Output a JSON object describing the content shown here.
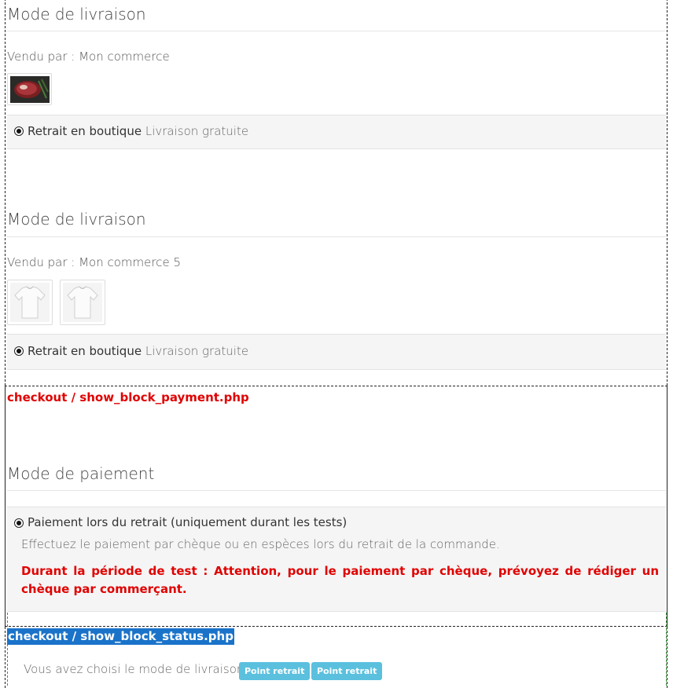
{
  "delivery_blocks": [
    {
      "title": "Mode de livraison",
      "vendor": "Vendu par : Mon commerce",
      "products": [
        {
          "icon": "steak-product-thumbnail"
        }
      ],
      "option": {
        "name": "Retrait en boutique",
        "detail": "Livraison gratuite"
      }
    },
    {
      "title": "Mode de livraison",
      "vendor": "Vendu par : Mon commerce 5",
      "products": [
        {
          "icon": "tshirt-product-thumbnail"
        },
        {
          "icon": "tshirt-product-thumbnail"
        }
      ],
      "option": {
        "name": "Retrait en boutique",
        "detail": "Livraison gratuite"
      }
    }
  ],
  "payment": {
    "debug_label": "checkout / show_block_payment.php",
    "title": "Mode de paiement",
    "option_name": "Paiement lors du retrait (uniquement durant les tests)",
    "description": "Effectuez le paiement par chèque ou en espèces lors du retrait de la commande.",
    "warning": "Durant la période de test : Attention, pour le paiement par chèque, prévoyez de rédiger un chèque par commerçant."
  },
  "status": {
    "debug_label": "checkout / show_block_status.php",
    "text": "Vous avez choisi le mode de livraison:",
    "badges": [
      "Point retrait",
      "Point retrait"
    ]
  },
  "colors": {
    "debug_red": "#e00000",
    "highlight_blue": "#1a73c9",
    "badge_blue": "#5bc0de"
  }
}
